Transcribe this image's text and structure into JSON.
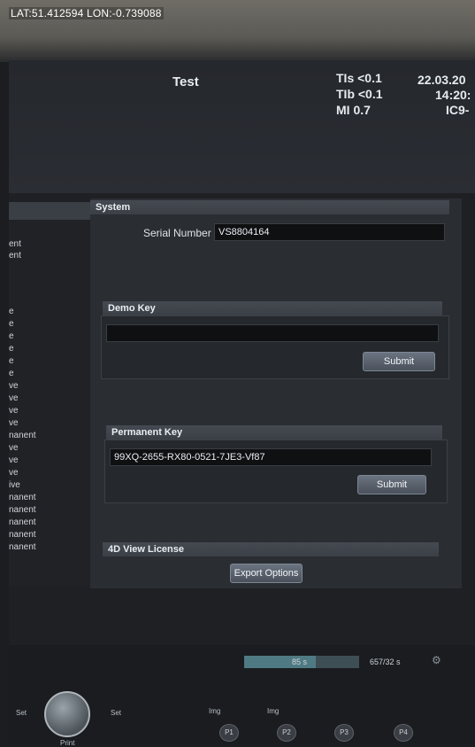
{
  "overlay": {
    "gps": "LAT:51.412594 LON:-0.739088"
  },
  "header": {
    "title": "Test",
    "metrics": [
      "TIs <0.1",
      "TIb <0.1",
      "MI  0.7"
    ],
    "date": "22.03.20",
    "time": "14:20:",
    "probe": "IC9-"
  },
  "left_panel": {
    "items": [
      "ent",
      "ent",
      "e",
      "e",
      "e",
      "e",
      "e",
      "e",
      "ve",
      "ve",
      "ve",
      "ve",
      "nanent",
      "ve",
      "ve",
      "ve",
      "ive",
      "nanent",
      "nanent",
      "nanent",
      "nanent",
      "nanent"
    ]
  },
  "system": {
    "section": "System",
    "serial_label": "Serial Number",
    "serial_value": "VS8804164"
  },
  "demo_key": {
    "section": "Demo Key",
    "value": "",
    "submit_label": "Submit"
  },
  "permanent_key": {
    "section": "Permanent Key",
    "value": "99XQ-2655-RX80-0521-7JE3-Vf87",
    "submit_label": "Submit"
  },
  "view_license": {
    "section": "4D View License",
    "export_label": "Export Options"
  },
  "bottom": {
    "progress_left": "85 s",
    "progress_right": "657/32 s",
    "progress_fraction": 0.62,
    "set_left": "Set",
    "set_right": "Set",
    "print": "Print",
    "img1": "Img",
    "img2": "Img",
    "p_buttons": [
      "P1",
      "P2",
      "P3",
      "P4"
    ],
    "gear_icon": "gear-icon"
  }
}
